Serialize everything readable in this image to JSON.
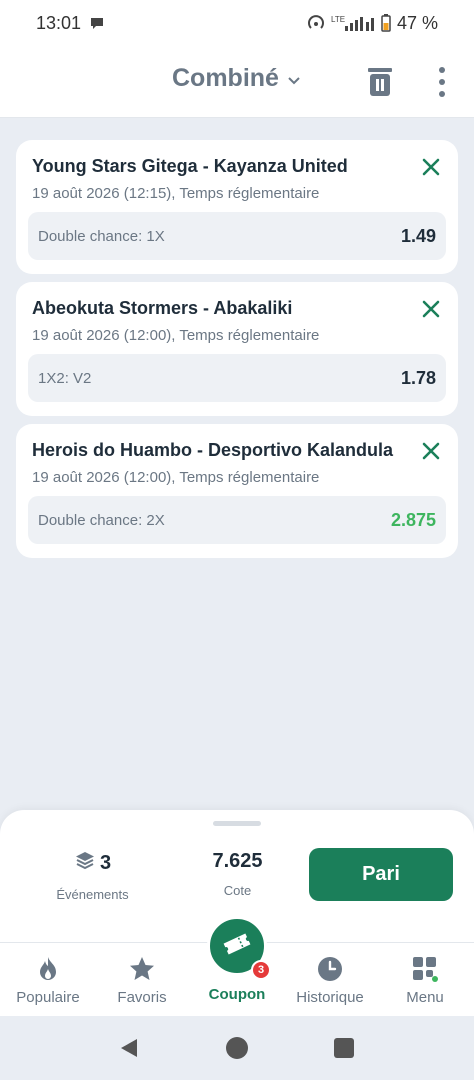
{
  "status_bar": {
    "time": "13:01",
    "battery": "47 %",
    "network": "LTE"
  },
  "header": {
    "title": "Combiné"
  },
  "bets": [
    {
      "match": "Young Stars Gitega - Kayanza United",
      "date": "19 août 2026 (12:15), Temps réglementaire",
      "pick": "Double chance: 1X",
      "odd": "1.49"
    },
    {
      "match": "Abeokuta Stormers - Abakaliki",
      "date": "19 août 2026 (12:00), Temps réglementaire",
      "pick": "1X2: V2",
      "odd": "1.78"
    },
    {
      "match": "Herois do Huambo - Desportivo Kalandula",
      "date": "19 août 2026 (12:00), Temps réglementaire",
      "pick": "Double chance: 2X",
      "odd": "2.875"
    }
  ],
  "summary": {
    "events_count": "3",
    "events_label": "Événements",
    "total_odds": "7.625",
    "odds_label": "Cote",
    "bet_button": "Pari"
  },
  "bottom_nav": {
    "items": [
      {
        "label": "Populaire",
        "icon": "flame-icon"
      },
      {
        "label": "Favoris",
        "icon": "star-icon"
      },
      {
        "label": "Coupon",
        "icon": "ticket-icon",
        "badge": "3"
      },
      {
        "label": "Historique",
        "icon": "clock-icon"
      },
      {
        "label": "Menu",
        "icon": "grid-icon"
      }
    ]
  },
  "colors": {
    "accent": "#1b7f5a",
    "odd_up": "#3db55e",
    "badge": "#e53a3a",
    "background": "#e9edf3"
  }
}
